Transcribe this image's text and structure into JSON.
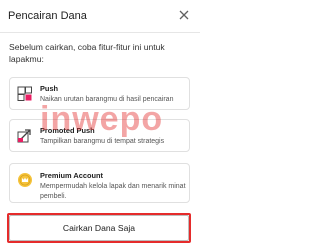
{
  "dialog": {
    "title": "Pencairan Dana",
    "close_icon": "close-icon",
    "intro": "Sebelum cairkan, coba fitur-fitur ini untuk lapakmu:"
  },
  "features": [
    {
      "name": "Push",
      "description": "Naikan urutan barangmu di hasil pencairan",
      "icon": "push-icon"
    },
    {
      "name": "Promoted Push",
      "description": "Tampilkan barangmu di tempat strategis",
      "icon": "promoted-push-icon"
    },
    {
      "name": "Premium Account",
      "description": "Mempermudah kelola lapak dan menarik minat pembeli.",
      "icon": "premium-account-icon"
    }
  ],
  "cta": {
    "label": "Cairkan Dana Saja"
  },
  "watermark": "inwepo",
  "colors": {
    "accent_red": "#e52b2b",
    "icon_pink": "#e91e63",
    "icon_gold": "#f5c33b"
  }
}
